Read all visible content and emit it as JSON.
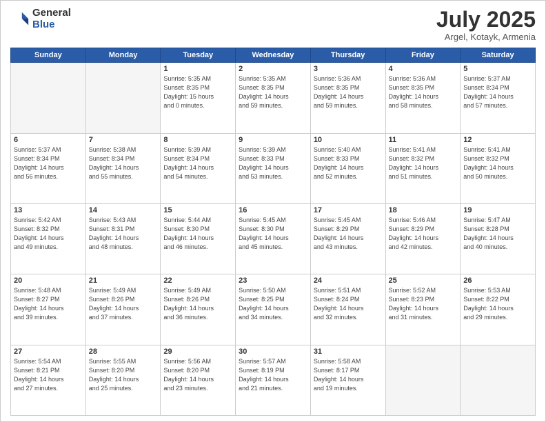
{
  "header": {
    "logo_general": "General",
    "logo_blue": "Blue",
    "month_title": "July 2025",
    "location": "Argel, Kotayk, Armenia"
  },
  "weekdays": [
    "Sunday",
    "Monday",
    "Tuesday",
    "Wednesday",
    "Thursday",
    "Friday",
    "Saturday"
  ],
  "weeks": [
    [
      {
        "day": "",
        "info": ""
      },
      {
        "day": "",
        "info": ""
      },
      {
        "day": "1",
        "info": "Sunrise: 5:35 AM\nSunset: 8:35 PM\nDaylight: 15 hours\nand 0 minutes."
      },
      {
        "day": "2",
        "info": "Sunrise: 5:35 AM\nSunset: 8:35 PM\nDaylight: 14 hours\nand 59 minutes."
      },
      {
        "day": "3",
        "info": "Sunrise: 5:36 AM\nSunset: 8:35 PM\nDaylight: 14 hours\nand 59 minutes."
      },
      {
        "day": "4",
        "info": "Sunrise: 5:36 AM\nSunset: 8:35 PM\nDaylight: 14 hours\nand 58 minutes."
      },
      {
        "day": "5",
        "info": "Sunrise: 5:37 AM\nSunset: 8:34 PM\nDaylight: 14 hours\nand 57 minutes."
      }
    ],
    [
      {
        "day": "6",
        "info": "Sunrise: 5:37 AM\nSunset: 8:34 PM\nDaylight: 14 hours\nand 56 minutes."
      },
      {
        "day": "7",
        "info": "Sunrise: 5:38 AM\nSunset: 8:34 PM\nDaylight: 14 hours\nand 55 minutes."
      },
      {
        "day": "8",
        "info": "Sunrise: 5:39 AM\nSunset: 8:34 PM\nDaylight: 14 hours\nand 54 minutes."
      },
      {
        "day": "9",
        "info": "Sunrise: 5:39 AM\nSunset: 8:33 PM\nDaylight: 14 hours\nand 53 minutes."
      },
      {
        "day": "10",
        "info": "Sunrise: 5:40 AM\nSunset: 8:33 PM\nDaylight: 14 hours\nand 52 minutes."
      },
      {
        "day": "11",
        "info": "Sunrise: 5:41 AM\nSunset: 8:32 PM\nDaylight: 14 hours\nand 51 minutes."
      },
      {
        "day": "12",
        "info": "Sunrise: 5:41 AM\nSunset: 8:32 PM\nDaylight: 14 hours\nand 50 minutes."
      }
    ],
    [
      {
        "day": "13",
        "info": "Sunrise: 5:42 AM\nSunset: 8:32 PM\nDaylight: 14 hours\nand 49 minutes."
      },
      {
        "day": "14",
        "info": "Sunrise: 5:43 AM\nSunset: 8:31 PM\nDaylight: 14 hours\nand 48 minutes."
      },
      {
        "day": "15",
        "info": "Sunrise: 5:44 AM\nSunset: 8:30 PM\nDaylight: 14 hours\nand 46 minutes."
      },
      {
        "day": "16",
        "info": "Sunrise: 5:45 AM\nSunset: 8:30 PM\nDaylight: 14 hours\nand 45 minutes."
      },
      {
        "day": "17",
        "info": "Sunrise: 5:45 AM\nSunset: 8:29 PM\nDaylight: 14 hours\nand 43 minutes."
      },
      {
        "day": "18",
        "info": "Sunrise: 5:46 AM\nSunset: 8:29 PM\nDaylight: 14 hours\nand 42 minutes."
      },
      {
        "day": "19",
        "info": "Sunrise: 5:47 AM\nSunset: 8:28 PM\nDaylight: 14 hours\nand 40 minutes."
      }
    ],
    [
      {
        "day": "20",
        "info": "Sunrise: 5:48 AM\nSunset: 8:27 PM\nDaylight: 14 hours\nand 39 minutes."
      },
      {
        "day": "21",
        "info": "Sunrise: 5:49 AM\nSunset: 8:26 PM\nDaylight: 14 hours\nand 37 minutes."
      },
      {
        "day": "22",
        "info": "Sunrise: 5:49 AM\nSunset: 8:26 PM\nDaylight: 14 hours\nand 36 minutes."
      },
      {
        "day": "23",
        "info": "Sunrise: 5:50 AM\nSunset: 8:25 PM\nDaylight: 14 hours\nand 34 minutes."
      },
      {
        "day": "24",
        "info": "Sunrise: 5:51 AM\nSunset: 8:24 PM\nDaylight: 14 hours\nand 32 minutes."
      },
      {
        "day": "25",
        "info": "Sunrise: 5:52 AM\nSunset: 8:23 PM\nDaylight: 14 hours\nand 31 minutes."
      },
      {
        "day": "26",
        "info": "Sunrise: 5:53 AM\nSunset: 8:22 PM\nDaylight: 14 hours\nand 29 minutes."
      }
    ],
    [
      {
        "day": "27",
        "info": "Sunrise: 5:54 AM\nSunset: 8:21 PM\nDaylight: 14 hours\nand 27 minutes."
      },
      {
        "day": "28",
        "info": "Sunrise: 5:55 AM\nSunset: 8:20 PM\nDaylight: 14 hours\nand 25 minutes."
      },
      {
        "day": "29",
        "info": "Sunrise: 5:56 AM\nSunset: 8:20 PM\nDaylight: 14 hours\nand 23 minutes."
      },
      {
        "day": "30",
        "info": "Sunrise: 5:57 AM\nSunset: 8:19 PM\nDaylight: 14 hours\nand 21 minutes."
      },
      {
        "day": "31",
        "info": "Sunrise: 5:58 AM\nSunset: 8:17 PM\nDaylight: 14 hours\nand 19 minutes."
      },
      {
        "day": "",
        "info": ""
      },
      {
        "day": "",
        "info": ""
      }
    ]
  ]
}
